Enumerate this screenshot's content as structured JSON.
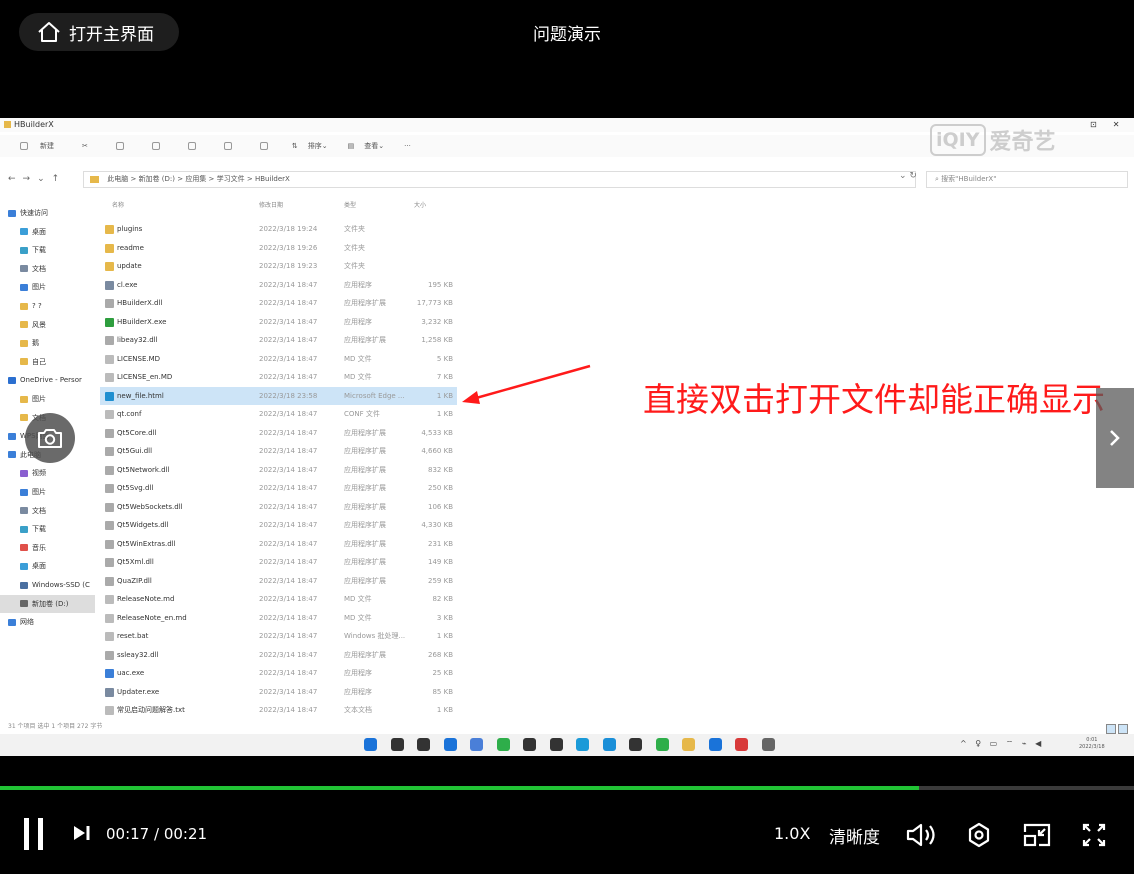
{
  "header": {
    "home_label": "打开主界面",
    "title": "问题演示"
  },
  "video": {
    "annotation_text": "直接双击打开文件却能正确显示",
    "watermark": {
      "logo": "iQIY",
      "text": "爱奇艺"
    }
  },
  "explorer": {
    "window_title": "HBuilderX",
    "toolbar": [
      "新建",
      "排序",
      "查看",
      "···"
    ],
    "breadcrumb": [
      "此电脑",
      "新加卷 (D:)",
      "应用集",
      "学习文件",
      "HBuilderX"
    ],
    "search_placeholder": "搜索\"HBuilderX\"",
    "columns": [
      "名称",
      "修改日期",
      "类型",
      "大小"
    ],
    "nav": [
      {
        "label": "快速访问",
        "color": "#3b7fd8",
        "indent": 0
      },
      {
        "label": "桌面",
        "color": "#3b9ed8",
        "indent": 1
      },
      {
        "label": "下载",
        "color": "#3aa0c8",
        "indent": 1
      },
      {
        "label": "文档",
        "color": "#7a8aa0",
        "indent": 1
      },
      {
        "label": "图片",
        "color": "#3b7fd8",
        "indent": 1
      },
      {
        "label": "? ?",
        "color": "#e6b84a",
        "indent": 1
      },
      {
        "label": "风景",
        "color": "#e6b84a",
        "indent": 1
      },
      {
        "label": "鹅",
        "color": "#e6b84a",
        "indent": 1
      },
      {
        "label": "自己",
        "color": "#e6b84a",
        "indent": 1
      },
      {
        "label": "OneDrive - Persor",
        "color": "#2b6fd0",
        "indent": 0
      },
      {
        "label": "图片",
        "color": "#e6b84a",
        "indent": 1
      },
      {
        "label": "文档",
        "color": "#e6b84a",
        "indent": 1
      },
      {
        "label": "WPS网盘",
        "color": "#3b7fd8",
        "indent": 0
      },
      {
        "label": "此电脑",
        "color": "#3b7fd8",
        "indent": 0
      },
      {
        "label": "视频",
        "color": "#8a5fd0",
        "indent": 1
      },
      {
        "label": "图片",
        "color": "#3b7fd8",
        "indent": 1
      },
      {
        "label": "文档",
        "color": "#7a8aa0",
        "indent": 1
      },
      {
        "label": "下载",
        "color": "#3aa0c8",
        "indent": 1
      },
      {
        "label": "音乐",
        "color": "#e0504a",
        "indent": 1
      },
      {
        "label": "桌面",
        "color": "#3b9ed8",
        "indent": 1
      },
      {
        "label": "Windows-SSD (C",
        "color": "#4a6fa0",
        "indent": 1
      },
      {
        "label": "新加卷 (D:)",
        "color": "#666666",
        "indent": 1
      },
      {
        "label": "网络",
        "color": "#3b7fd8",
        "indent": 0
      }
    ],
    "nav_selected_index": 21,
    "files": [
      {
        "name": "plugins",
        "date": "2022/3/18 19:24",
        "type": "文件夹",
        "size": "",
        "color": "#e6b84a"
      },
      {
        "name": "readme",
        "date": "2022/3/18 19:26",
        "type": "文件夹",
        "size": "",
        "color": "#e6b84a"
      },
      {
        "name": "update",
        "date": "2022/3/18 19:23",
        "type": "文件夹",
        "size": "",
        "color": "#e6b84a"
      },
      {
        "name": "cl.exe",
        "date": "2022/3/14 18:47",
        "type": "应用程序",
        "size": "195 KB",
        "color": "#7a8aa0"
      },
      {
        "name": "HBuilderX.dll",
        "date": "2022/3/14 18:47",
        "type": "应用程序扩展",
        "size": "17,773 KB",
        "color": "#aaaaaa"
      },
      {
        "name": "HBuilderX.exe",
        "date": "2022/3/14 18:47",
        "type": "应用程序",
        "size": "3,232 KB",
        "color": "#2e9e3e"
      },
      {
        "name": "libeay32.dll",
        "date": "2022/3/14 18:47",
        "type": "应用程序扩展",
        "size": "1,258 KB",
        "color": "#aaaaaa"
      },
      {
        "name": "LICENSE.MD",
        "date": "2022/3/14 18:47",
        "type": "MD 文件",
        "size": "5 KB",
        "color": "#bbbbbb"
      },
      {
        "name": "LICENSE_en.MD",
        "date": "2022/3/14 18:47",
        "type": "MD 文件",
        "size": "7 KB",
        "color": "#bbbbbb"
      },
      {
        "name": "new_file.html",
        "date": "2022/3/18 23:58",
        "type": "Microsoft Edge ...",
        "size": "1 KB",
        "color": "#1f8fd0"
      },
      {
        "name": "qt.conf",
        "date": "2022/3/14 18:47",
        "type": "CONF 文件",
        "size": "1 KB",
        "color": "#bbbbbb"
      },
      {
        "name": "Qt5Core.dll",
        "date": "2022/3/14 18:47",
        "type": "应用程序扩展",
        "size": "4,533 KB",
        "color": "#aaaaaa"
      },
      {
        "name": "Qt5Gui.dll",
        "date": "2022/3/14 18:47",
        "type": "应用程序扩展",
        "size": "4,660 KB",
        "color": "#aaaaaa"
      },
      {
        "name": "Qt5Network.dll",
        "date": "2022/3/14 18:47",
        "type": "应用程序扩展",
        "size": "832 KB",
        "color": "#aaaaaa"
      },
      {
        "name": "Qt5Svg.dll",
        "date": "2022/3/14 18:47",
        "type": "应用程序扩展",
        "size": "250 KB",
        "color": "#aaaaaa"
      },
      {
        "name": "Qt5WebSockets.dll",
        "date": "2022/3/14 18:47",
        "type": "应用程序扩展",
        "size": "106 KB",
        "color": "#aaaaaa"
      },
      {
        "name": "Qt5Widgets.dll",
        "date": "2022/3/14 18:47",
        "type": "应用程序扩展",
        "size": "4,330 KB",
        "color": "#aaaaaa"
      },
      {
        "name": "Qt5WinExtras.dll",
        "date": "2022/3/14 18:47",
        "type": "应用程序扩展",
        "size": "231 KB",
        "color": "#aaaaaa"
      },
      {
        "name": "Qt5Xml.dll",
        "date": "2022/3/14 18:47",
        "type": "应用程序扩展",
        "size": "149 KB",
        "color": "#aaaaaa"
      },
      {
        "name": "QuaZIP.dll",
        "date": "2022/3/14 18:47",
        "type": "应用程序扩展",
        "size": "259 KB",
        "color": "#aaaaaa"
      },
      {
        "name": "ReleaseNote.md",
        "date": "2022/3/14 18:47",
        "type": "MD 文件",
        "size": "82 KB",
        "color": "#bbbbbb"
      },
      {
        "name": "ReleaseNote_en.md",
        "date": "2022/3/14 18:47",
        "type": "MD 文件",
        "size": "3 KB",
        "color": "#bbbbbb"
      },
      {
        "name": "reset.bat",
        "date": "2022/3/14 18:47",
        "type": "Windows 批处理...",
        "size": "1 KB",
        "color": "#bbbbbb"
      },
      {
        "name": "ssleay32.dll",
        "date": "2022/3/14 18:47",
        "type": "应用程序扩展",
        "size": "268 KB",
        "color": "#aaaaaa"
      },
      {
        "name": "uac.exe",
        "date": "2022/3/14 18:47",
        "type": "应用程序",
        "size": "25 KB",
        "color": "#3b7fd8"
      },
      {
        "name": "Updater.exe",
        "date": "2022/3/14 18:47",
        "type": "应用程序",
        "size": "85 KB",
        "color": "#7a8aa0"
      },
      {
        "name": "常见启动问题解答.txt",
        "date": "2022/3/14 18:47",
        "type": "文本文档",
        "size": "1 KB",
        "color": "#bbbbbb"
      }
    ],
    "selected_file_index": 9,
    "status_bar": "31 个项目   选中 1 个项目  272 字节",
    "taskbar_apps": [
      "#1a73d9",
      "#333333",
      "#333333",
      "#1a73d9",
      "#4a7fd8",
      "#2eae4a",
      "#333333",
      "#333333",
      "#1a9ad8",
      "#1a8fd8",
      "#333333",
      "#2eae4a",
      "#e6b84a",
      "#1a73d9",
      "#d83a3a",
      "#666666"
    ],
    "tray_icons": "^ ♀ ▭ ⌔ ⌁ ◀",
    "tray_time": "0:01",
    "tray_date": "2022/3/18"
  },
  "player": {
    "current_time": "00:17",
    "total_time": "00:21",
    "time_display": "00:17 / 00:21",
    "progress": 0.81,
    "speed_label": "1.0X",
    "quality_label": "清晰度",
    "accent_color": "#21c435"
  }
}
